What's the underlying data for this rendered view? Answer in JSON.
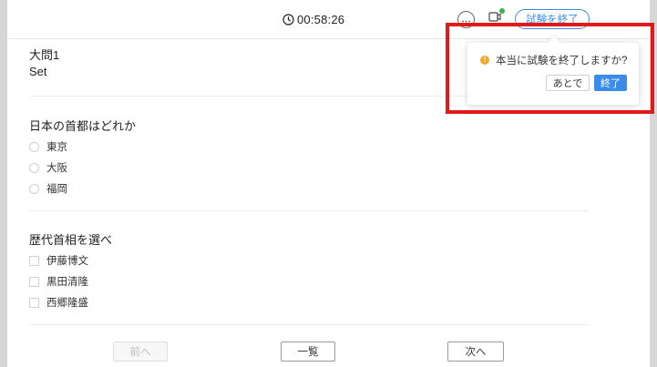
{
  "header": {
    "timer": "00:58:26",
    "end_exam_label": "試験を終了"
  },
  "section": {
    "title": "大問1",
    "subtitle": "Set"
  },
  "questions": [
    {
      "text": "日本の首都はどれか",
      "type": "radio",
      "options": [
        "東京",
        "大阪",
        "福岡"
      ]
    },
    {
      "text": "歴代首相を選べ",
      "type": "checkbox",
      "options": [
        "伊藤博文",
        "黒田清隆",
        "西郷隆盛"
      ]
    }
  ],
  "navigation": {
    "prev_label": "前へ",
    "list_label": "一覧",
    "next_label": "次へ"
  },
  "confirm_popup": {
    "message": "本当に試験を終了しますか?",
    "later_label": "あとで",
    "confirm_label": "終了"
  },
  "colors": {
    "accent": "#3b8ce8",
    "warning": "#f5a623",
    "highlight": "#e01a1a",
    "camera_status": "#3bb54a"
  },
  "icons": [
    "clock-icon",
    "chat-icon",
    "camera-icon",
    "warning-icon"
  ]
}
